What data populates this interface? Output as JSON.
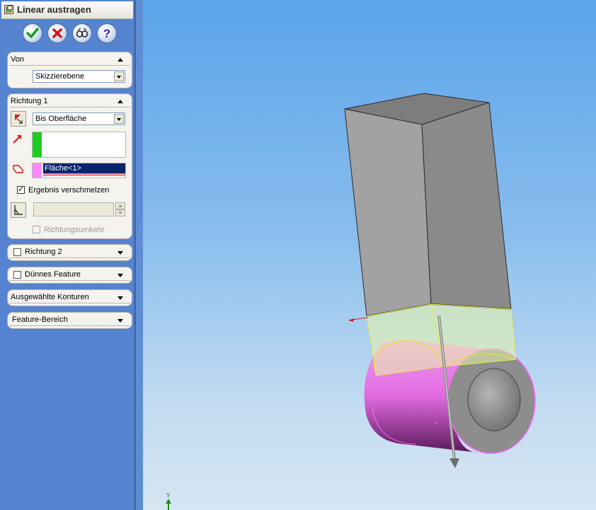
{
  "panel": {
    "title": "Linear austragen",
    "buttons": [
      "ok-icon",
      "cancel-icon",
      "preview-icon",
      "help-icon"
    ]
  },
  "von": {
    "header": "Von",
    "start_condition": "Skizzierebene"
  },
  "richtung1": {
    "header": "Richtung 1",
    "end_condition": "Bis Oberfläche",
    "direction_value": "",
    "face_selection": "Fläche<1>",
    "merge_result_label": "Ergebnis verschmelzen",
    "merge_result_checked": true,
    "draft_value": "",
    "reverse_label": "Richtungsumkehr",
    "reverse_checked": false
  },
  "richtung2": {
    "header": "Richtung 2",
    "checked": false
  },
  "thin_feature": {
    "header": "Dünnes Feature",
    "checked": false
  },
  "contours": {
    "header": "Ausgewählte Konturen"
  },
  "feature_scope": {
    "header": "Feature-Bereich"
  },
  "colors": {
    "panel_bg": "#5583cf",
    "group_bg": "#f4f3ee",
    "direction_color": "#1fcc1f",
    "face_color": "#ff88ff",
    "selection_bg": "#0a246a",
    "body_gray": "#909090",
    "cylinder_pink": "#e26ae2",
    "preview_yellow": "#eaf5a8"
  },
  "viewport": {
    "triad_axis": "Y"
  }
}
